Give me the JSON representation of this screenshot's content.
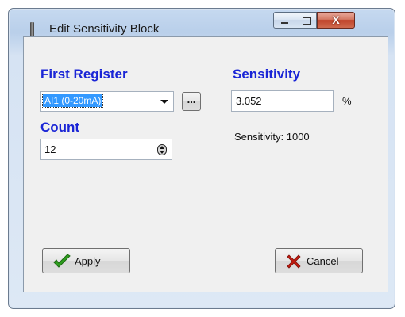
{
  "window": {
    "title": "Edit Sensitivity Block",
    "minimize_icon": "minimize-icon",
    "maximize_icon": "maximize-icon",
    "close_glyph": "X"
  },
  "first_register": {
    "label": "First Register",
    "value": "AI1 (0-20mA)",
    "browse_label": "..."
  },
  "count": {
    "label": "Count",
    "value": "12"
  },
  "sensitivity": {
    "label": "Sensitivity",
    "value": "3.052",
    "unit": "%",
    "info": "Sensitivity: 1000"
  },
  "buttons": {
    "apply_label": "Apply",
    "cancel_label": "Cancel",
    "apply_icon": "checkmark-icon",
    "cancel_icon": "x-icon",
    "apply_color": "#2f9e1f",
    "cancel_color": "#c21b10"
  },
  "colors": {
    "label_blue": "#1a25d6",
    "selection": "#3399ff"
  }
}
